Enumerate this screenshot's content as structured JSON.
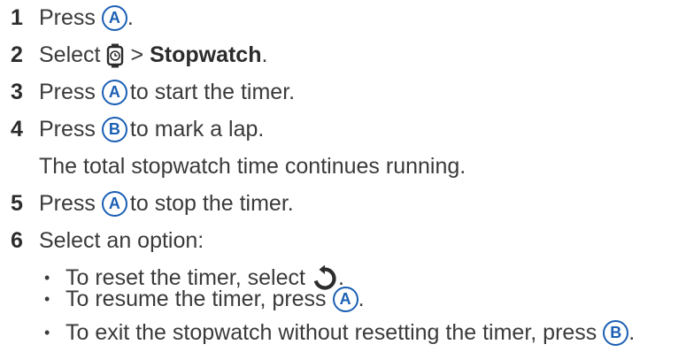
{
  "colors": {
    "text": "#3a3a3a",
    "button_icon": "#1a5fb4",
    "glyph": "#2c2c2c"
  },
  "icons": {
    "button_a": "A",
    "button_b": "B",
    "watch": "watch-icon",
    "reset": "reset-icon",
    "bullet": "•"
  },
  "steps": [
    {
      "num": "1",
      "pre": "Press",
      "post": "."
    },
    {
      "num": "2",
      "pre": "Select",
      "sep": ">",
      "bold": "Stopwatch",
      "post": "."
    },
    {
      "num": "3",
      "pre": "Press",
      "post": "to start the timer."
    },
    {
      "num": "4",
      "pre": "Press",
      "post": "to mark a lap.",
      "note": "The total stopwatch time continues running."
    },
    {
      "num": "5",
      "pre": "Press",
      "post": "to stop the timer."
    },
    {
      "num": "6",
      "pre": "Select an option:"
    }
  ],
  "options": [
    {
      "pre": "To reset the timer, select",
      "post": "."
    },
    {
      "pre": "To resume the timer, press",
      "post": "."
    },
    {
      "pre": "To exit the stopwatch without resetting the timer, press",
      "post": "."
    }
  ]
}
